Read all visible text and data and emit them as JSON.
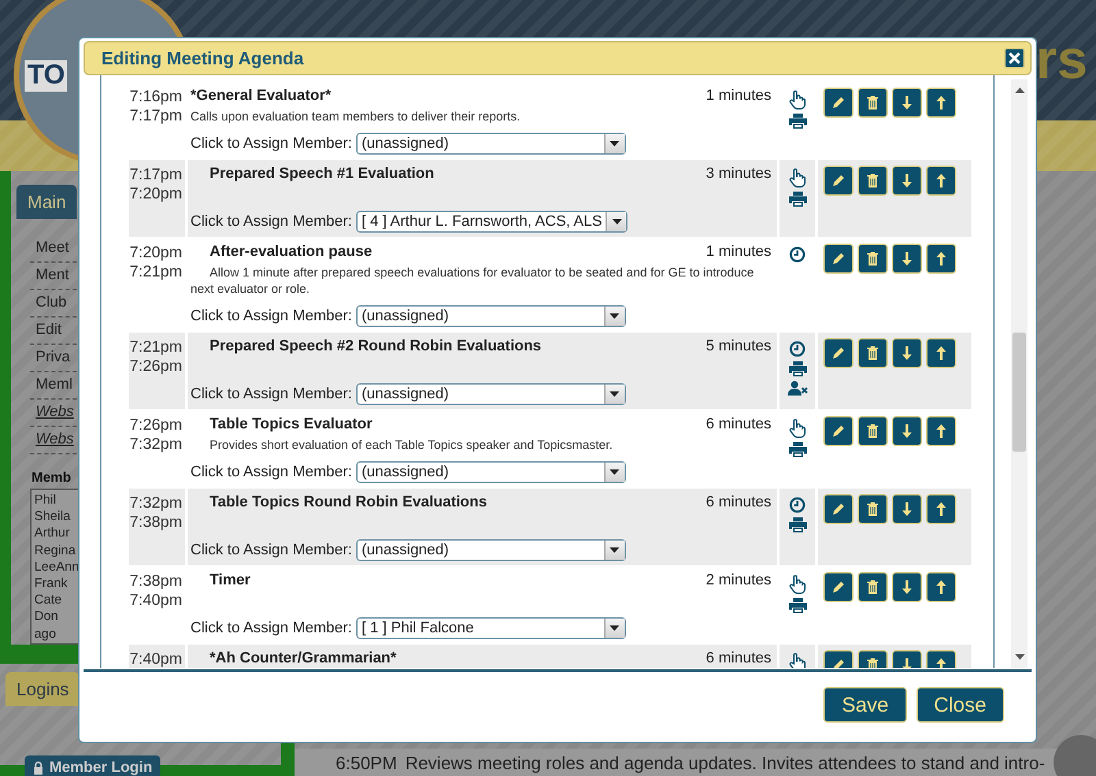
{
  "background": {
    "logo_text": "TO",
    "heading_fragment": "rs",
    "sidebar_tab": "Main",
    "menu": [
      {
        "label": "Meet",
        "italic": false
      },
      {
        "label": "Ment",
        "italic": false
      },
      {
        "label": "Club",
        "italic": false
      },
      {
        "label": "Edit",
        "italic": false
      },
      {
        "label": "Priva",
        "italic": false
      },
      {
        "label": "Meml",
        "italic": false
      },
      {
        "label": "Webs",
        "italic": true
      },
      {
        "label": "Webs",
        "italic": true
      }
    ],
    "members_heading": "Memb",
    "members": [
      "Phil",
      "Sheila",
      "Arthur",
      "Regina",
      "LeeAnn",
      "Frank",
      "Cate",
      "Don",
      "ago"
    ],
    "logins_tab": "Logins",
    "login_button": "Member Login",
    "agenda_time": "6:50PM",
    "agenda_text": "Reviews meeting roles and agenda updates. Invites attendees to stand and intro-"
  },
  "dialog": {
    "title": "Editing Meeting Agenda",
    "rows": [
      {
        "start": "7:16pm",
        "end": "7:17pm",
        "title": "*General Evaluator*",
        "indented": false,
        "description": "Calls upon evaluation team members to deliver their reports.",
        "duration": "1 minutes",
        "icons": [
          {
            "kind": "hand"
          },
          {
            "kind": "print"
          }
        ],
        "assign_label": "Click to Assign Member:",
        "member": "(unassigned)",
        "shaded": false
      },
      {
        "start": "7:17pm",
        "end": "7:20pm",
        "title": "Prepared Speech #1 Evaluation",
        "indented": true,
        "duration": "3 minutes",
        "icons": [
          {
            "kind": "hand"
          },
          {
            "kind": "print"
          }
        ],
        "assign_label": "Click to Assign Member:",
        "member": "[ 4 ] Arthur L. Farnsworth, ACS, ALS",
        "shaded": true
      },
      {
        "start": "7:20pm",
        "end": "7:21pm",
        "title": "After-evaluation pause",
        "indented": true,
        "description": "Allow 1 minute after prepared speech evaluations for evaluator to be seated and for GE to introduce next evaluator or role.",
        "duration": "1 minutes",
        "icons": [
          {
            "kind": "clock"
          }
        ],
        "assign_label": "Click to Assign Member:",
        "member": "(unassigned)",
        "shaded": false
      },
      {
        "start": "7:21pm",
        "end": "7:26pm",
        "title": "Prepared Speech #2 Round Robin Evaluations",
        "indented": true,
        "duration": "5 minutes",
        "icons": [
          {
            "kind": "clock"
          },
          {
            "kind": "print"
          },
          {
            "kind": "user-remove"
          }
        ],
        "assign_label": "Click to Assign Member:",
        "member": "(unassigned)",
        "shaded": true
      },
      {
        "start": "7:26pm",
        "end": "7:32pm",
        "title": "Table Topics Evaluator",
        "indented": true,
        "description": "Provides short evaluation of each Table Topics speaker and Topicsmaster.",
        "duration": "6 minutes",
        "icons": [
          {
            "kind": "hand"
          },
          {
            "kind": "print"
          }
        ],
        "assign_label": "Click to Assign Member:",
        "member": "(unassigned)",
        "shaded": false
      },
      {
        "start": "7:32pm",
        "end": "7:38pm",
        "title": "Table Topics Round Robin Evaluations",
        "indented": true,
        "duration": "6 minutes",
        "icons": [
          {
            "kind": "clock"
          },
          {
            "kind": "print"
          }
        ],
        "assign_label": "Click to Assign Member:",
        "member": "(unassigned)",
        "shaded": true
      },
      {
        "start": "7:38pm",
        "end": "7:40pm",
        "title": "Timer",
        "indented": true,
        "duration": "2 minutes",
        "icons": [
          {
            "kind": "hand"
          },
          {
            "kind": "print"
          }
        ],
        "assign_label": "Click to Assign Member:",
        "member": "[ 1 ] Phil Falcone",
        "shaded": false
      },
      {
        "start": "7:40pm",
        "title": "*Ah Counter/Grammarian*",
        "indented": true,
        "duration": "6 minutes",
        "icons": [
          {
            "kind": "hand"
          }
        ],
        "shaded": true
      }
    ],
    "buttons": [
      {
        "label": "Save"
      },
      {
        "label": "Close"
      }
    ]
  }
}
